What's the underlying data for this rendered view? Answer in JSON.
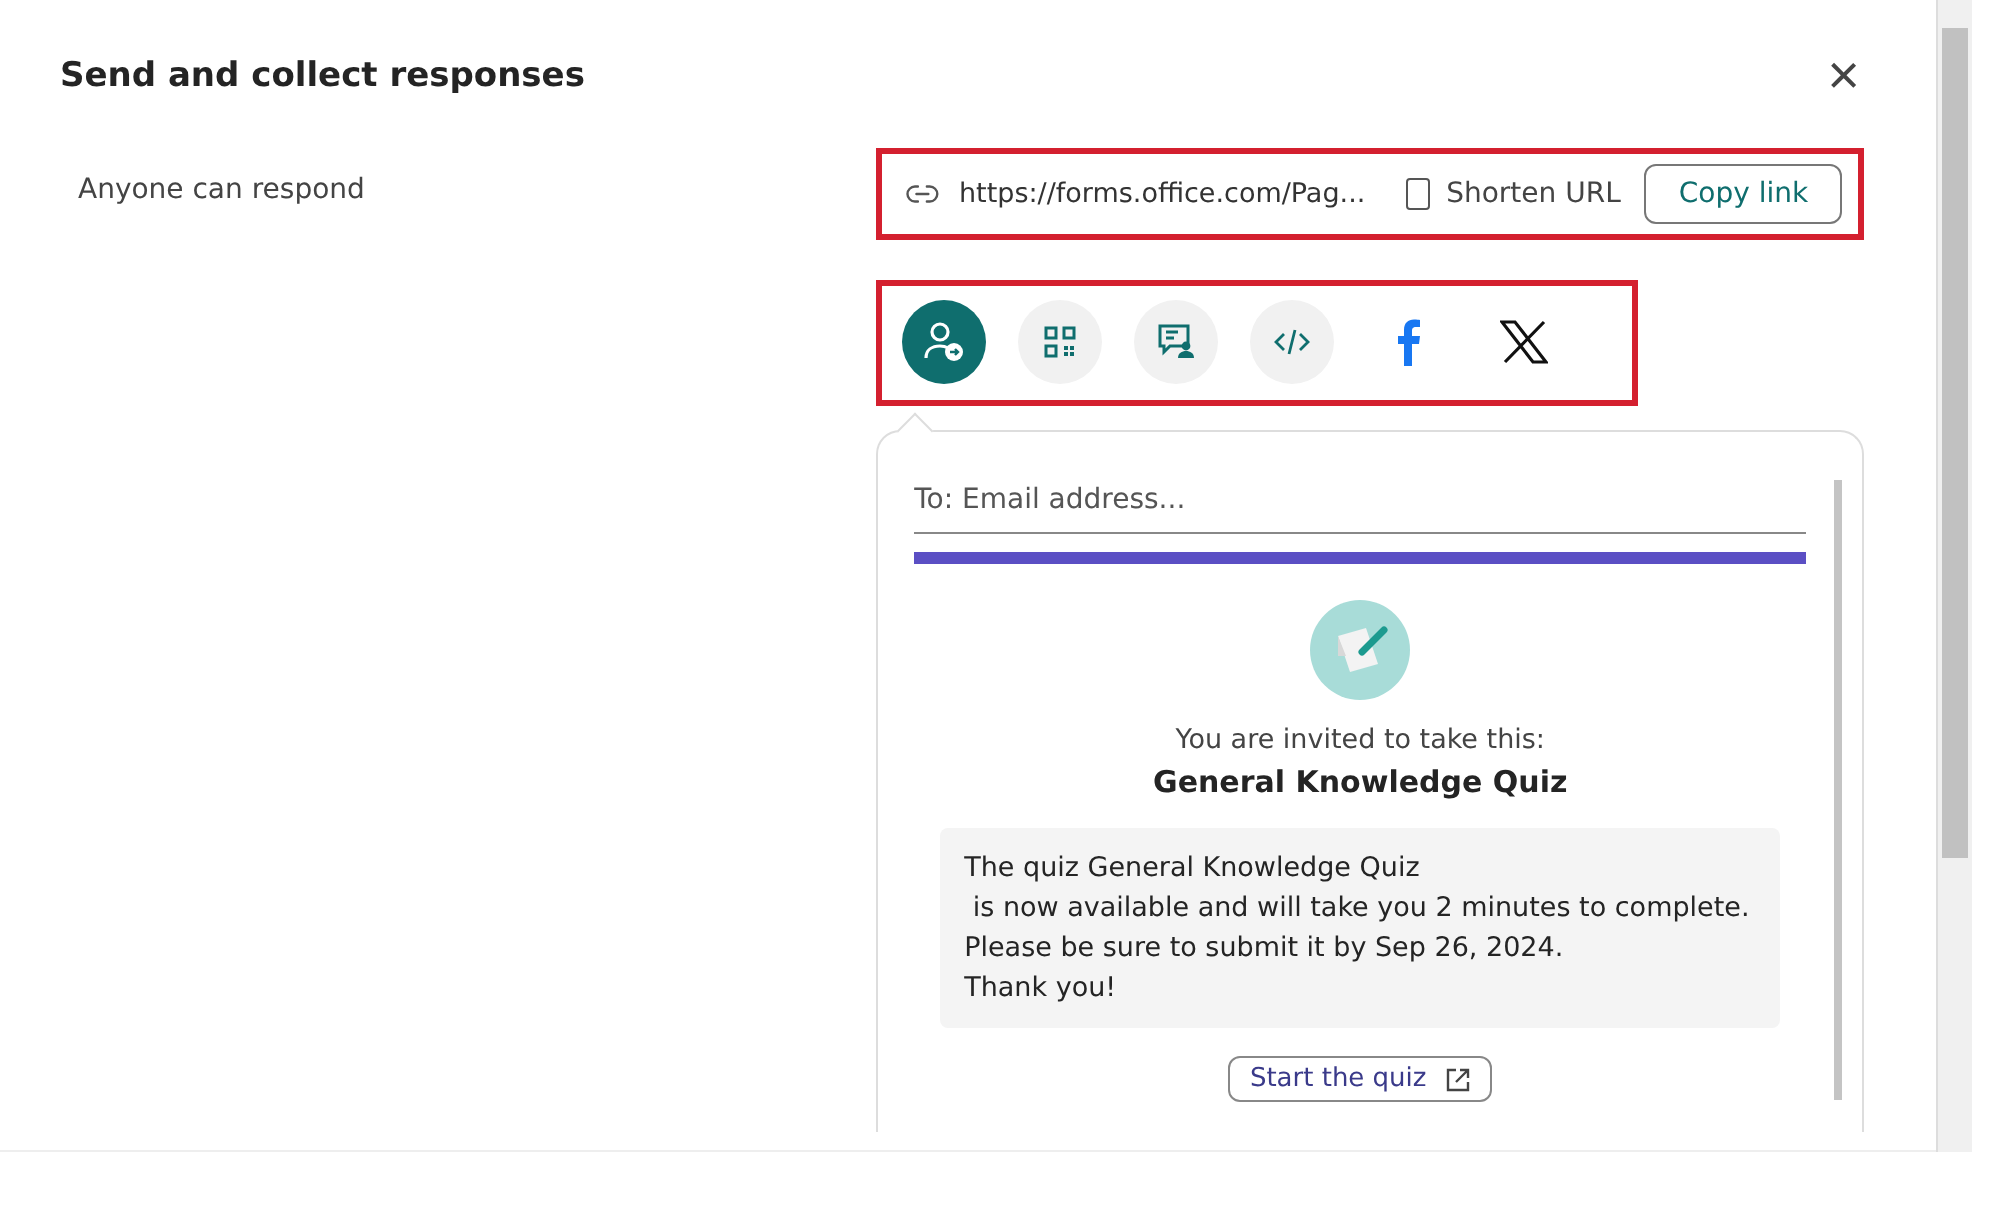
{
  "dialog": {
    "title": "Send and collect responses",
    "close": "×"
  },
  "audience": "Anyone can respond",
  "link_bar": {
    "url": "https://forms.office.com/Pag...",
    "shorten_url": {
      "label": "Shorten URL",
      "checked": false
    },
    "copy_button": "Copy link",
    "highlighted": true
  },
  "share_options": {
    "highlighted": true,
    "items": [
      {
        "kind": "email",
        "selected": true
      },
      {
        "kind": "qr",
        "selected": false
      },
      {
        "kind": "embed-message",
        "selected": false
      },
      {
        "kind": "code",
        "selected": false
      },
      {
        "kind": "facebook",
        "selected": false
      },
      {
        "kind": "x",
        "selected": false
      }
    ]
  },
  "email_panel": {
    "to_placeholder": "To: Email address...",
    "invite_line": "You are invited to take this:",
    "quiz_title": "General Knowledge Quiz",
    "message_lines": [
      "The quiz General Knowledge Quiz",
      " is now available and will take you 2 minutes to complete.",
      "Please be sure to submit it by Sep 26, 2024.",
      "Thank you!"
    ],
    "start_button": "Start the quiz"
  }
}
